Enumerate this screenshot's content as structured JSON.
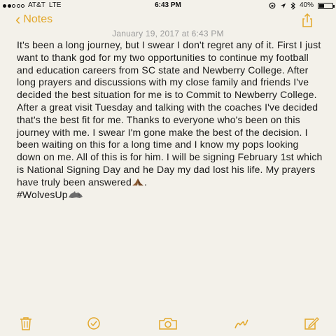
{
  "status_bar": {
    "signal_bars": 5,
    "signal_filled": 2,
    "carrier": "AT&T",
    "network": "LTE",
    "time": "6:43 PM",
    "icons": [
      "lock-rotation-icon",
      "location-arrow-icon",
      "bluetooth-icon"
    ],
    "battery_percent": "40%",
    "battery_level": 0.4
  },
  "nav": {
    "back_label": "Notes",
    "back_icon": "chevron-left-icon",
    "share_icon": "share-icon",
    "accent_color": "#e3a82b"
  },
  "note": {
    "date": "January 19, 2017 at 6:43 PM",
    "body_main": "It's been a long journey, but I swear I don't regret any of it. First I just want to thank god for my two opportunities to continue my football and education careers from SC state and Newberry College. After long prayers and discussions with my close family and friends I've decided the best situation for me is to Commit to Newberry College. After a great visit Tuesday and talking with the coaches I've decided that's the best fit for me. Thanks to everyone who's been on this journey with me. I swear I'm gone make the best of the decision. I been waiting on this for a long time and I know my pops looking down on me. All of this is for him. I will be signing February 1st which is National Signing Day and he Day my dad lost his life. My prayers have truly been answered",
    "body_after_emoji": ".",
    "hashtag": "#WolvesUp",
    "emoji_1": "praying-hands-emoji",
    "emoji_2": "wolf-emoji"
  },
  "toolbar": {
    "items": [
      "trash-icon",
      "checklist-icon",
      "camera-icon",
      "sketch-icon",
      "compose-icon"
    ]
  }
}
